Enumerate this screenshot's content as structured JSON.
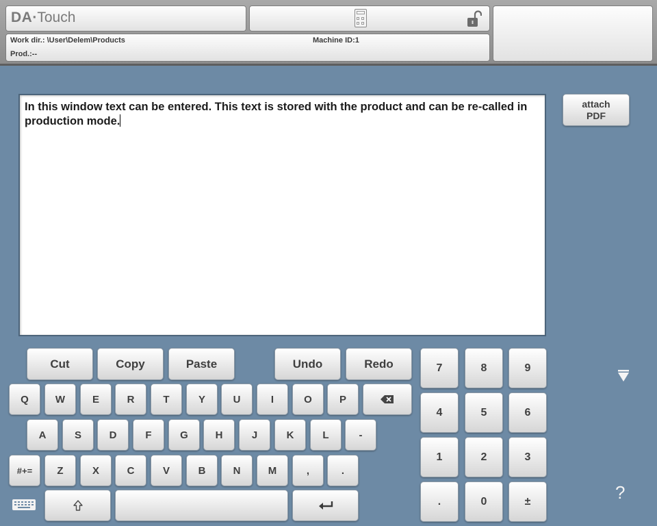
{
  "header": {
    "logo_part1": "DA",
    "logo_dot": "·",
    "logo_part2": "Touch",
    "work_dir": "Work dir.: \\User\\Delem\\Products",
    "machine_id": "Machine ID:1",
    "product": "Prod.:--"
  },
  "editor": {
    "text": "In this window text can be entered. This text is stored with the product and can be re-called in production mode."
  },
  "attach_button": {
    "line1": "attach",
    "line2": "PDF"
  },
  "edit_buttons": [
    "Cut",
    "Copy",
    "Paste",
    "Undo",
    "Redo"
  ],
  "keyboard": {
    "row1": [
      "Q",
      "W",
      "E",
      "R",
      "T",
      "Y",
      "U",
      "I",
      "O",
      "P"
    ],
    "row2": [
      "A",
      "S",
      "D",
      "F",
      "G",
      "H",
      "J",
      "K",
      "L",
      "-"
    ],
    "row3": [
      "#+=",
      "Z",
      "X",
      "C",
      "V",
      "B",
      "N",
      "M",
      ",",
      "."
    ]
  },
  "numpad": [
    "7",
    "8",
    "9",
    "4",
    "5",
    "6",
    "1",
    "2",
    "3",
    ".",
    "0",
    "±"
  ],
  "help_label": "?",
  "icons": [
    "calculator-icon",
    "unlock-icon",
    "backspace-icon",
    "shift-icon",
    "enter-icon",
    "keyboard-icon",
    "dropdown-triangle-icon"
  ],
  "colors": {
    "background": "#6d8aa5",
    "header": "#9a9a9a"
  }
}
